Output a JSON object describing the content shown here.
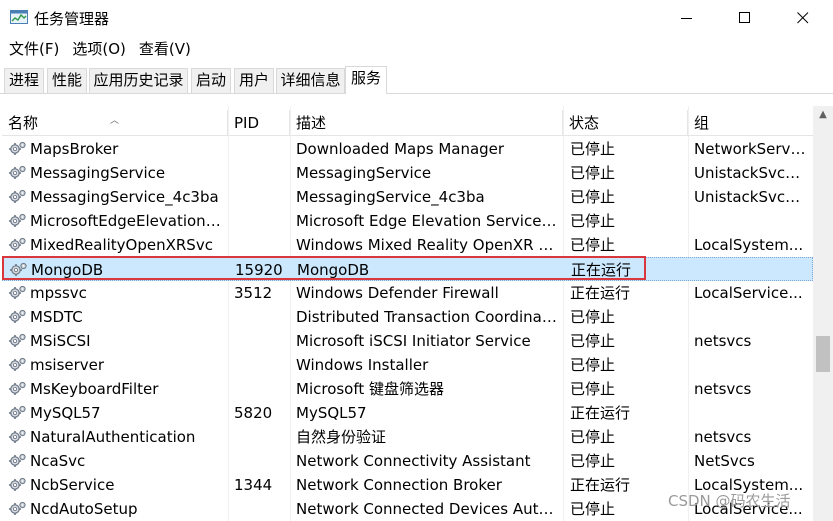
{
  "window": {
    "title": "任务管理器",
    "app_icon": "task-manager-icon"
  },
  "menu": [
    "文件(F)",
    "选项(O)",
    "查看(V)"
  ],
  "tabs": [
    "进程",
    "性能",
    "应用历史记录",
    "启动",
    "用户",
    "详细信息",
    "服务"
  ],
  "active_tab": "服务",
  "columns": {
    "name": "名称",
    "pid": "PID",
    "desc": "描述",
    "status": "状态",
    "group": "组"
  },
  "rows": [
    {
      "name": "MapsBroker",
      "pid": "",
      "desc": "Downloaded Maps Manager",
      "status": "已停止",
      "group": "NetworkServi..."
    },
    {
      "name": "MessagingService",
      "pid": "",
      "desc": "MessagingService",
      "status": "已停止",
      "group": "UnistackSvcG..."
    },
    {
      "name": "MessagingService_4c3ba",
      "pid": "",
      "desc": "MessagingService_4c3ba",
      "status": "已停止",
      "group": "UnistackSvcG..."
    },
    {
      "name": "MicrosoftEdgeElevationS...",
      "pid": "",
      "desc": "Microsoft Edge Elevation Service ...",
      "status": "已停止",
      "group": ""
    },
    {
      "name": "MixedRealityOpenXRSvc",
      "pid": "",
      "desc": "Windows Mixed Reality OpenXR S...",
      "status": "已停止",
      "group": "LocalSystem..."
    },
    {
      "name": "MongoDB",
      "pid": "15920",
      "desc": "MongoDB",
      "status": "正在运行",
      "group": ""
    },
    {
      "name": "mpssvc",
      "pid": "3512",
      "desc": "Windows Defender Firewall",
      "status": "正在运行",
      "group": "LocalService..."
    },
    {
      "name": "MSDTC",
      "pid": "",
      "desc": "Distributed Transaction Coordinat...",
      "status": "已停止",
      "group": ""
    },
    {
      "name": "MSiSCSI",
      "pid": "",
      "desc": "Microsoft iSCSI Initiator Service",
      "status": "已停止",
      "group": "netsvcs"
    },
    {
      "name": "msiserver",
      "pid": "",
      "desc": "Windows Installer",
      "status": "已停止",
      "group": ""
    },
    {
      "name": "MsKeyboardFilter",
      "pid": "",
      "desc": "Microsoft 键盘筛选器",
      "status": "已停止",
      "group": "netsvcs"
    },
    {
      "name": "MySQL57",
      "pid": "5820",
      "desc": "MySQL57",
      "status": "正在运行",
      "group": ""
    },
    {
      "name": "NaturalAuthentication",
      "pid": "",
      "desc": "自然身份验证",
      "status": "已停止",
      "group": "netsvcs"
    },
    {
      "name": "NcaSvc",
      "pid": "",
      "desc": "Network Connectivity Assistant",
      "status": "已停止",
      "group": "NetSvcs"
    },
    {
      "name": "NcbService",
      "pid": "1344",
      "desc": "Network Connection Broker",
      "status": "正在运行",
      "group": "LocalSystem..."
    },
    {
      "name": "NcdAutoSetup",
      "pid": "",
      "desc": "Network Connected Devices Auto...",
      "status": "已停止",
      "group": "LocalService..."
    }
  ],
  "selected_row": "MongoDB",
  "watermark": "CSDN @码农生活",
  "colors": {
    "selected_bg": "#cce8ff",
    "highlight_border": "#d9363e"
  }
}
